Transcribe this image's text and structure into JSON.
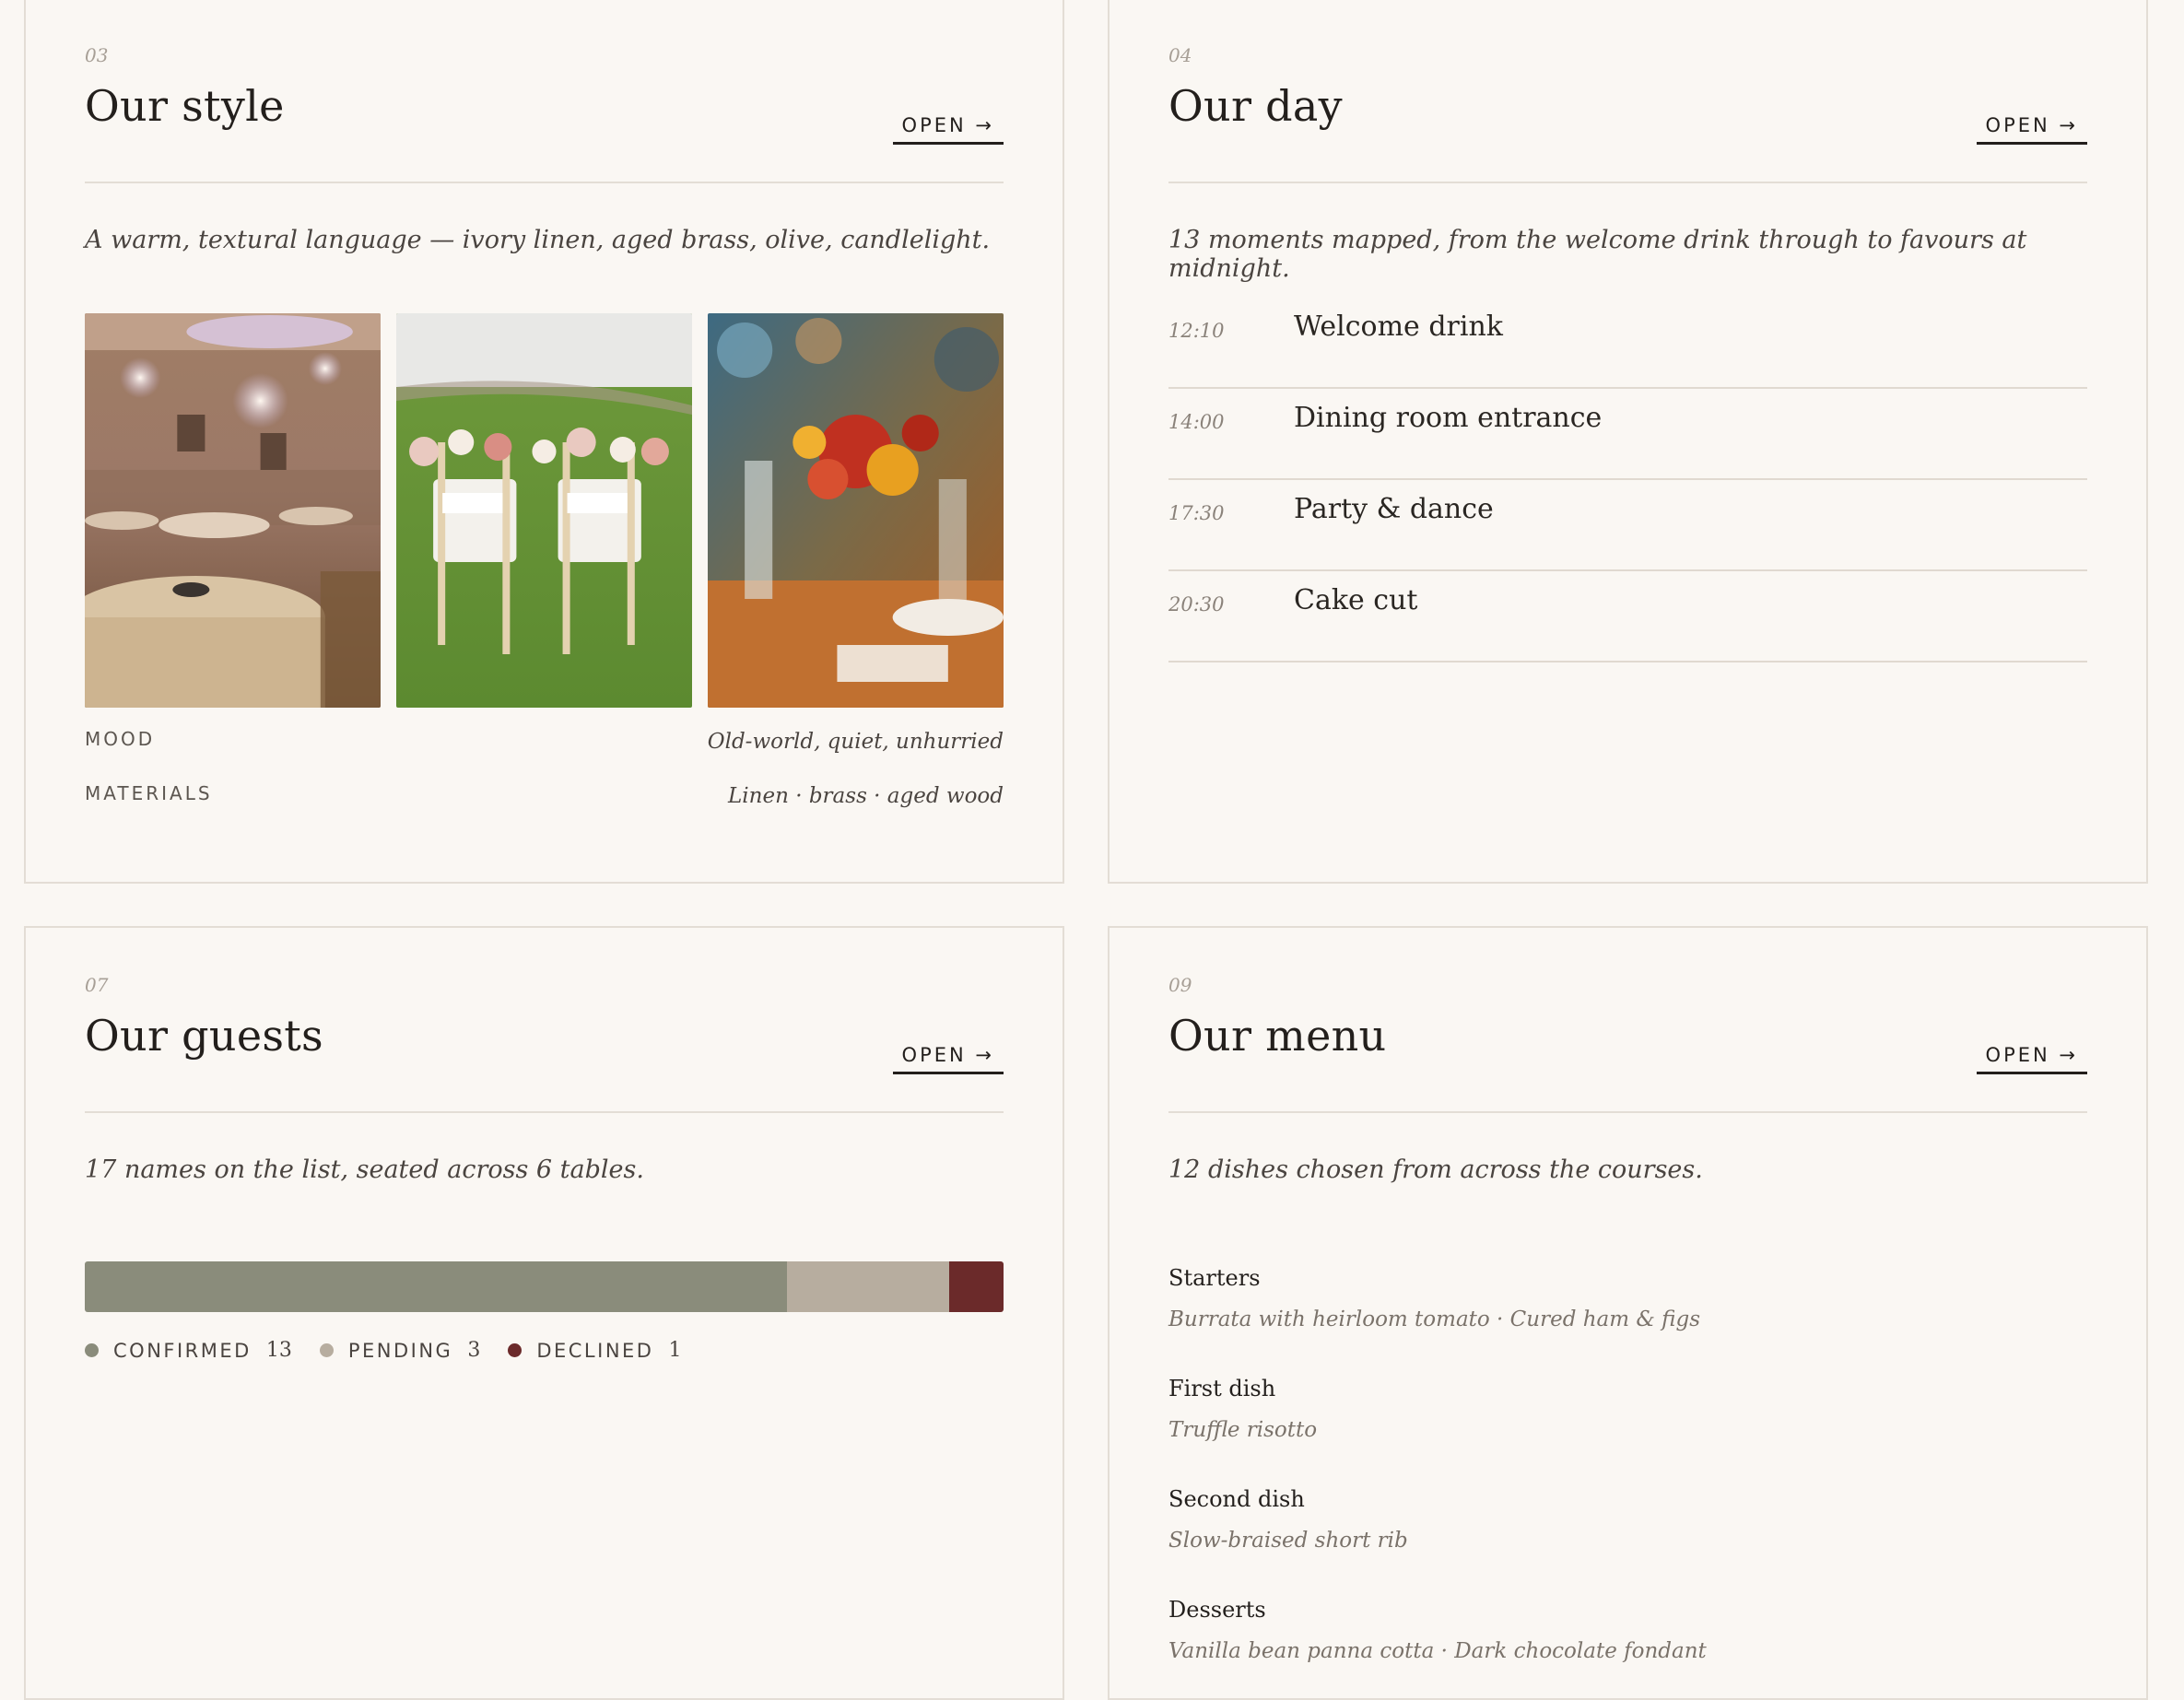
{
  "style": {
    "number": "03",
    "title": "Our style",
    "open": "OPEN →",
    "lead": "A warm, textural language — ivory linen, aged brass, olive, candlelight.",
    "photos": [
      "ballroom-photo",
      "chairs-on-lawn-photo",
      "table-florals-photo"
    ],
    "meta": [
      {
        "label": "MOOD",
        "value": "Old-world, quiet, unhurried"
      },
      {
        "label": "MATERIALS",
        "value": "Linen · brass · aged wood"
      }
    ]
  },
  "day": {
    "number": "04",
    "title": "Our day",
    "open": "OPEN →",
    "lead": "13 moments mapped, from the welcome drink through to favours at midnight.",
    "moments": [
      {
        "time": "12:10",
        "name": "Welcome drink"
      },
      {
        "time": "14:00",
        "name": "Dining room entrance"
      },
      {
        "time": "17:30",
        "name": "Party & dance"
      },
      {
        "time": "20:30",
        "name": "Cake cut"
      }
    ]
  },
  "guests": {
    "number": "07",
    "title": "Our guests",
    "open": "OPEN →",
    "lead": "17 names on the list, seated across 6 tables.",
    "status": [
      {
        "label": "CONFIRMED",
        "count": "13",
        "value": 13,
        "color": "#8a8c7b"
      },
      {
        "label": "PENDING",
        "count": "3",
        "value": 3,
        "color": "#b7ad9f"
      },
      {
        "label": "DECLINED",
        "count": "1",
        "value": 1,
        "color": "#6b2a2a"
      }
    ]
  },
  "menu": {
    "number": "09",
    "title": "Our menu",
    "open": "OPEN →",
    "lead": "12 dishes chosen from across the courses.",
    "courses": [
      {
        "name": "Starters",
        "dishes": "Burrata with heirloom tomato · Cured ham & figs"
      },
      {
        "name": "First dish",
        "dishes": "Truffle risotto"
      },
      {
        "name": "Second dish",
        "dishes": "Slow-braised short rib"
      },
      {
        "name": "Desserts",
        "dishes": "Vanilla bean panna cotta · Dark chocolate fondant"
      }
    ]
  }
}
